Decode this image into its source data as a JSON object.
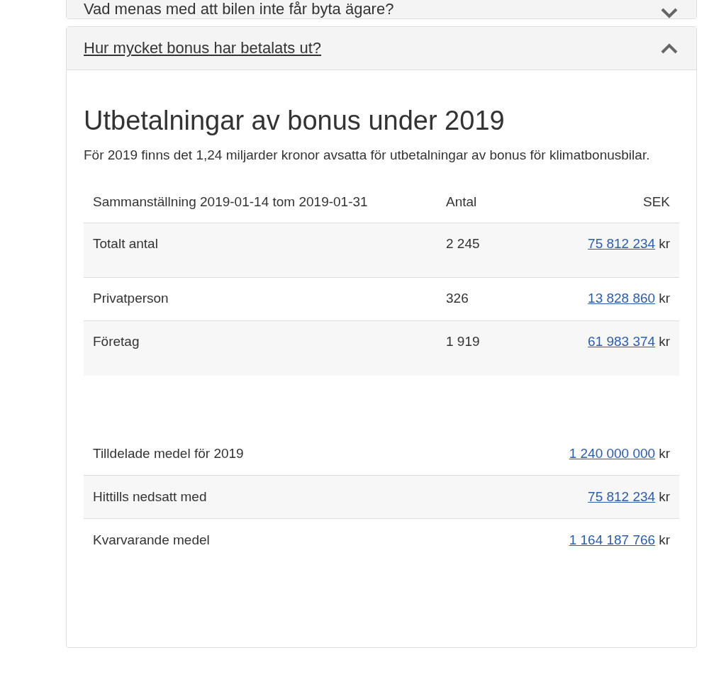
{
  "panels": [
    {
      "title": "Vad menas med att bilen inte får byta ägare?",
      "expanded": false
    },
    {
      "title": "Hur mycket bonus har betalats ut?",
      "expanded": true
    }
  ],
  "content": {
    "heading": "Utbetalningar av bonus under 2019",
    "paragraph": "För 2019 finns det 1,24 miljarder kronor avsatta för utbetalningar av bonus för klimatbonusbilar.",
    "summary_table": {
      "columns": [
        "Sammanställning 2019-01-14 tom 2019-01-31",
        "Antal",
        "SEK"
      ],
      "rows": [
        {
          "label": "Totalt antal",
          "count": "2 245",
          "amount": "75 812 234",
          "unit": "kr"
        },
        {
          "label": "Privatperson",
          "count": "326",
          "amount": "13 828 860",
          "unit": "kr"
        },
        {
          "label": "Företag",
          "count": "1 919",
          "amount": "61 983 374",
          "unit": "kr"
        }
      ]
    },
    "funds_table": {
      "rows": [
        {
          "label": "Tilldelade medel för 2019",
          "amount": "1 240 000 000",
          "unit": "kr"
        },
        {
          "label": "Hittills nedsatt med",
          "amount": "75 812 234",
          "unit": "kr"
        },
        {
          "label": "Kvarvarande medel",
          "amount": "1 164 187 766",
          "unit": "kr"
        }
      ]
    }
  }
}
